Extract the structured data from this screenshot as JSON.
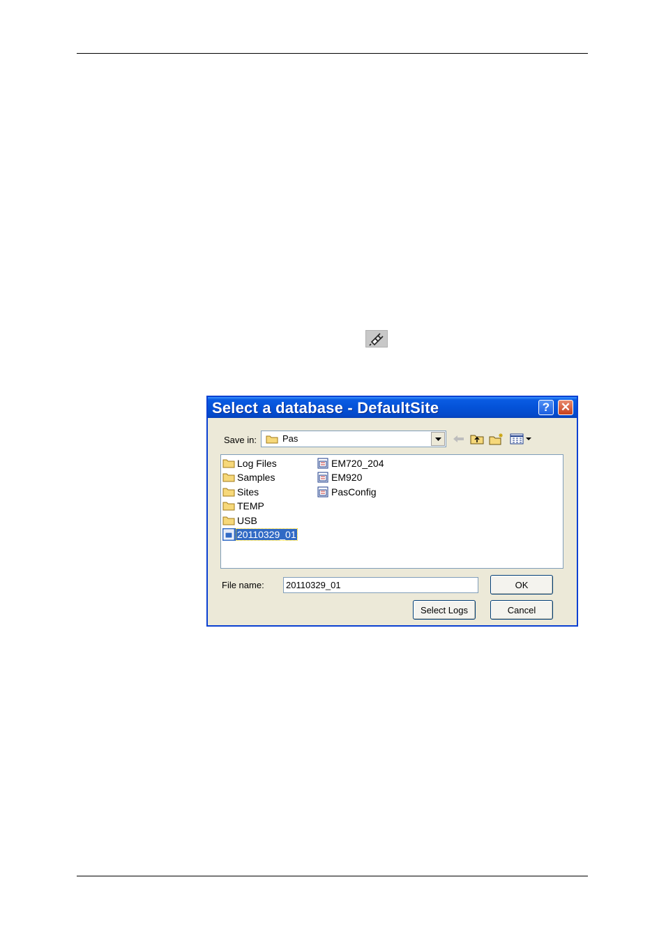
{
  "dialog": {
    "title": "Select a database - DefaultSite",
    "help_glyph": "?",
    "close_glyph": "✕",
    "save_in_label": "Save in:",
    "save_in_value": "Pas",
    "file_name_label": "File name:",
    "file_name_value": "20110329_01",
    "ok_label": "OK",
    "select_logs_label": "Select Logs",
    "cancel_label": "Cancel",
    "folders": [
      "Log Files",
      "Samples",
      "Sites",
      "TEMP",
      "USB"
    ],
    "selected_file": "20110329_01",
    "files": [
      "EM720_204",
      "EM920",
      "PasConfig"
    ]
  },
  "icons": {
    "toolbar_button": "connect-plug-icon",
    "back": "back-arrow-icon",
    "up": "up-folder-icon",
    "new_folder": "new-folder-icon",
    "views": "views-menu-icon"
  },
  "colors": {
    "title_bar": "#0452d8",
    "dialog_face": "#ece9d8",
    "selection": "#316ac5"
  }
}
